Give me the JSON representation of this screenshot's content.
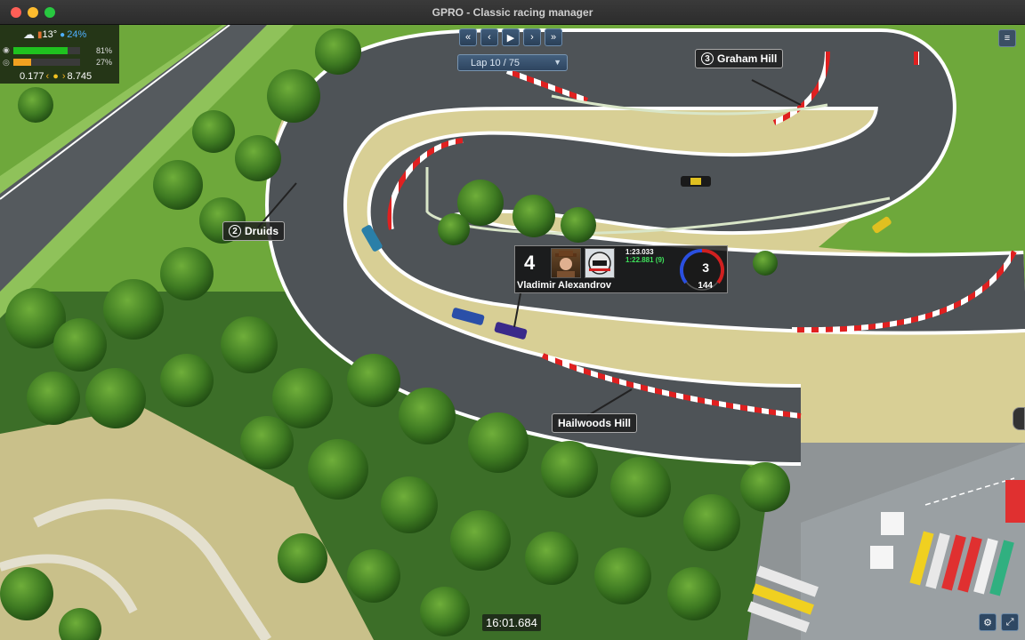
{
  "window": {
    "title": "GPRO - Classic racing manager"
  },
  "hud": {
    "weather_icon": "cloud-icon",
    "temperature": "13°",
    "humidity": "24%",
    "bar1_percent": "81%",
    "bar1_value": 0.81,
    "bar2_percent": "27%",
    "bar2_value": 0.27,
    "gap_ahead": "0.177",
    "gap_behind": "8.745",
    "colors": {
      "bar1": "#1fc21f",
      "bar2": "#f0a020"
    }
  },
  "controls": {
    "rewind_label": "«",
    "prev_label": "‹",
    "play_label": "▶",
    "next_label": "›",
    "forward_label": "»",
    "lap_label": "Lap 10 / 75",
    "menu_label": "≡"
  },
  "corners": [
    {
      "number": "2",
      "name": "Druids"
    },
    {
      "number": "3",
      "name": "Graham Hill"
    },
    {
      "number": "",
      "name": "Hailwoods Hill"
    }
  ],
  "driver": {
    "position": "4",
    "name": "Vladimir Alexandrov",
    "lap_time": "1:23.033",
    "best_time": "1:22.881 (9)",
    "gear": "3",
    "speed": "144"
  },
  "race_clock": "16:01.684",
  "bottom_right": {
    "settings_label": "⚙",
    "fullscreen_label": "⤢"
  }
}
